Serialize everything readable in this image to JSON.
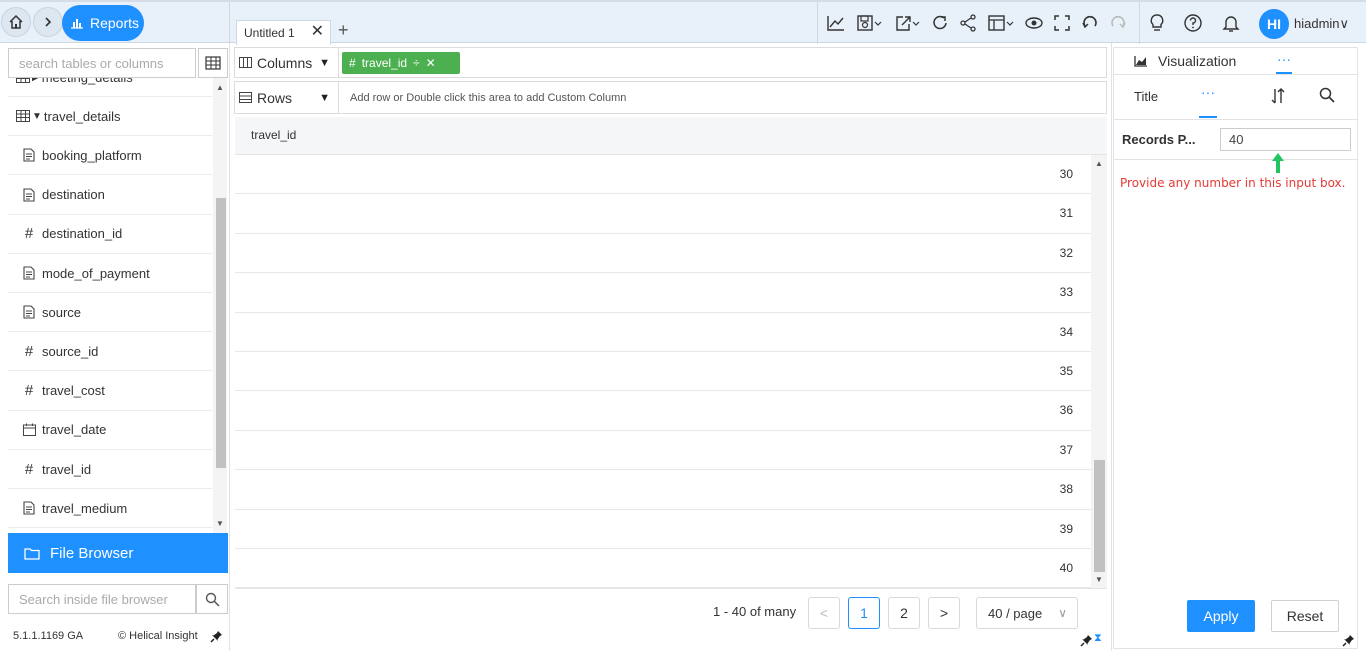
{
  "topbar": {
    "reports_label": "Reports",
    "tab_label": "Untitled 1",
    "username": "hiadmin",
    "avatar_initials": "HI",
    "accent": "#1e90ff",
    "toolbar_icons": [
      "line-chart-icon",
      "save-icon",
      "export-icon",
      "refresh-icon",
      "share-icon",
      "layout-icon",
      "preview-icon",
      "fullscreen-icon",
      "undo-icon",
      "redo-icon",
      "lightbulb-icon",
      "help-icon",
      "bell-icon"
    ]
  },
  "left": {
    "search_placeholder": "search tables or columns",
    "tree": [
      {
        "type": "table-collapsed",
        "label": "meeting_details",
        "icon": "table-icon"
      },
      {
        "type": "table-expanded",
        "label": "travel_details",
        "icon": "table-icon"
      },
      {
        "type": "text",
        "label": "booking_platform",
        "icon": "text-field-icon"
      },
      {
        "type": "text",
        "label": "destination",
        "icon": "text-field-icon"
      },
      {
        "type": "number",
        "label": "destination_id",
        "icon": "number-field-icon"
      },
      {
        "type": "text",
        "label": "mode_of_payment",
        "icon": "text-field-icon"
      },
      {
        "type": "text",
        "label": "source",
        "icon": "text-field-icon"
      },
      {
        "type": "number",
        "label": "source_id",
        "icon": "number-field-icon"
      },
      {
        "type": "number",
        "label": "travel_cost",
        "icon": "number-field-icon"
      },
      {
        "type": "date",
        "label": "travel_date",
        "icon": "date-field-icon"
      },
      {
        "type": "number",
        "label": "travel_id",
        "icon": "number-field-icon"
      },
      {
        "type": "text",
        "label": "travel_medium",
        "icon": "text-field-icon"
      }
    ],
    "file_browser_label": "File Browser",
    "file_search_placeholder": "Search inside file browser",
    "version": "5.1.1.1169 GA",
    "brand": "© Helical Insight"
  },
  "center": {
    "columns_label": "Columns",
    "rows_label": "Rows",
    "column_chip": "travel_id",
    "rows_hint": "Add row or Double click this area to add Custom Column",
    "grid_header": "travel_id",
    "grid_values": [
      "30",
      "31",
      "32",
      "33",
      "34",
      "35",
      "36",
      "37",
      "38",
      "39",
      "40"
    ],
    "pager": {
      "summary": "1 - 40 of many",
      "prev": "<",
      "page1": "1",
      "page2": "2",
      "next": ">",
      "page_size": "40 / page"
    }
  },
  "right": {
    "visualization_label": "Visualization",
    "more_label": "···",
    "title_label": "Title",
    "records_label": "Records P...",
    "records_value": "40",
    "hint": "Provide any number in this input box.",
    "apply_label": "Apply",
    "reset_label": "Reset",
    "hint_color": "#e53935",
    "arrow_color": "#22c55e"
  }
}
